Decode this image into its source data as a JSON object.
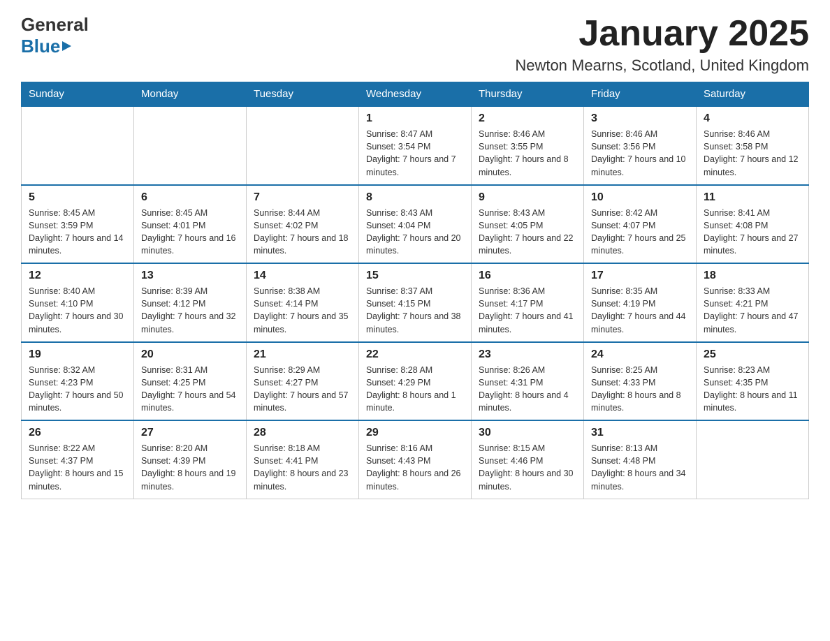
{
  "header": {
    "logo_line1": "General",
    "logo_line2": "Blue",
    "month_title": "January 2025",
    "location": "Newton Mearns, Scotland, United Kingdom"
  },
  "weekdays": [
    "Sunday",
    "Monday",
    "Tuesday",
    "Wednesday",
    "Thursday",
    "Friday",
    "Saturday"
  ],
  "weeks": [
    [
      {
        "day": "",
        "sunrise": "",
        "sunset": "",
        "daylight": ""
      },
      {
        "day": "",
        "sunrise": "",
        "sunset": "",
        "daylight": ""
      },
      {
        "day": "",
        "sunrise": "",
        "sunset": "",
        "daylight": ""
      },
      {
        "day": "1",
        "sunrise": "Sunrise: 8:47 AM",
        "sunset": "Sunset: 3:54 PM",
        "daylight": "Daylight: 7 hours and 7 minutes."
      },
      {
        "day": "2",
        "sunrise": "Sunrise: 8:46 AM",
        "sunset": "Sunset: 3:55 PM",
        "daylight": "Daylight: 7 hours and 8 minutes."
      },
      {
        "day": "3",
        "sunrise": "Sunrise: 8:46 AM",
        "sunset": "Sunset: 3:56 PM",
        "daylight": "Daylight: 7 hours and 10 minutes."
      },
      {
        "day": "4",
        "sunrise": "Sunrise: 8:46 AM",
        "sunset": "Sunset: 3:58 PM",
        "daylight": "Daylight: 7 hours and 12 minutes."
      }
    ],
    [
      {
        "day": "5",
        "sunrise": "Sunrise: 8:45 AM",
        "sunset": "Sunset: 3:59 PM",
        "daylight": "Daylight: 7 hours and 14 minutes."
      },
      {
        "day": "6",
        "sunrise": "Sunrise: 8:45 AM",
        "sunset": "Sunset: 4:01 PM",
        "daylight": "Daylight: 7 hours and 16 minutes."
      },
      {
        "day": "7",
        "sunrise": "Sunrise: 8:44 AM",
        "sunset": "Sunset: 4:02 PM",
        "daylight": "Daylight: 7 hours and 18 minutes."
      },
      {
        "day": "8",
        "sunrise": "Sunrise: 8:43 AM",
        "sunset": "Sunset: 4:04 PM",
        "daylight": "Daylight: 7 hours and 20 minutes."
      },
      {
        "day": "9",
        "sunrise": "Sunrise: 8:43 AM",
        "sunset": "Sunset: 4:05 PM",
        "daylight": "Daylight: 7 hours and 22 minutes."
      },
      {
        "day": "10",
        "sunrise": "Sunrise: 8:42 AM",
        "sunset": "Sunset: 4:07 PM",
        "daylight": "Daylight: 7 hours and 25 minutes."
      },
      {
        "day": "11",
        "sunrise": "Sunrise: 8:41 AM",
        "sunset": "Sunset: 4:08 PM",
        "daylight": "Daylight: 7 hours and 27 minutes."
      }
    ],
    [
      {
        "day": "12",
        "sunrise": "Sunrise: 8:40 AM",
        "sunset": "Sunset: 4:10 PM",
        "daylight": "Daylight: 7 hours and 30 minutes."
      },
      {
        "day": "13",
        "sunrise": "Sunrise: 8:39 AM",
        "sunset": "Sunset: 4:12 PM",
        "daylight": "Daylight: 7 hours and 32 minutes."
      },
      {
        "day": "14",
        "sunrise": "Sunrise: 8:38 AM",
        "sunset": "Sunset: 4:14 PM",
        "daylight": "Daylight: 7 hours and 35 minutes."
      },
      {
        "day": "15",
        "sunrise": "Sunrise: 8:37 AM",
        "sunset": "Sunset: 4:15 PM",
        "daylight": "Daylight: 7 hours and 38 minutes."
      },
      {
        "day": "16",
        "sunrise": "Sunrise: 8:36 AM",
        "sunset": "Sunset: 4:17 PM",
        "daylight": "Daylight: 7 hours and 41 minutes."
      },
      {
        "day": "17",
        "sunrise": "Sunrise: 8:35 AM",
        "sunset": "Sunset: 4:19 PM",
        "daylight": "Daylight: 7 hours and 44 minutes."
      },
      {
        "day": "18",
        "sunrise": "Sunrise: 8:33 AM",
        "sunset": "Sunset: 4:21 PM",
        "daylight": "Daylight: 7 hours and 47 minutes."
      }
    ],
    [
      {
        "day": "19",
        "sunrise": "Sunrise: 8:32 AM",
        "sunset": "Sunset: 4:23 PM",
        "daylight": "Daylight: 7 hours and 50 minutes."
      },
      {
        "day": "20",
        "sunrise": "Sunrise: 8:31 AM",
        "sunset": "Sunset: 4:25 PM",
        "daylight": "Daylight: 7 hours and 54 minutes."
      },
      {
        "day": "21",
        "sunrise": "Sunrise: 8:29 AM",
        "sunset": "Sunset: 4:27 PM",
        "daylight": "Daylight: 7 hours and 57 minutes."
      },
      {
        "day": "22",
        "sunrise": "Sunrise: 8:28 AM",
        "sunset": "Sunset: 4:29 PM",
        "daylight": "Daylight: 8 hours and 1 minute."
      },
      {
        "day": "23",
        "sunrise": "Sunrise: 8:26 AM",
        "sunset": "Sunset: 4:31 PM",
        "daylight": "Daylight: 8 hours and 4 minutes."
      },
      {
        "day": "24",
        "sunrise": "Sunrise: 8:25 AM",
        "sunset": "Sunset: 4:33 PM",
        "daylight": "Daylight: 8 hours and 8 minutes."
      },
      {
        "day": "25",
        "sunrise": "Sunrise: 8:23 AM",
        "sunset": "Sunset: 4:35 PM",
        "daylight": "Daylight: 8 hours and 11 minutes."
      }
    ],
    [
      {
        "day": "26",
        "sunrise": "Sunrise: 8:22 AM",
        "sunset": "Sunset: 4:37 PM",
        "daylight": "Daylight: 8 hours and 15 minutes."
      },
      {
        "day": "27",
        "sunrise": "Sunrise: 8:20 AM",
        "sunset": "Sunset: 4:39 PM",
        "daylight": "Daylight: 8 hours and 19 minutes."
      },
      {
        "day": "28",
        "sunrise": "Sunrise: 8:18 AM",
        "sunset": "Sunset: 4:41 PM",
        "daylight": "Daylight: 8 hours and 23 minutes."
      },
      {
        "day": "29",
        "sunrise": "Sunrise: 8:16 AM",
        "sunset": "Sunset: 4:43 PM",
        "daylight": "Daylight: 8 hours and 26 minutes."
      },
      {
        "day": "30",
        "sunrise": "Sunrise: 8:15 AM",
        "sunset": "Sunset: 4:46 PM",
        "daylight": "Daylight: 8 hours and 30 minutes."
      },
      {
        "day": "31",
        "sunrise": "Sunrise: 8:13 AM",
        "sunset": "Sunset: 4:48 PM",
        "daylight": "Daylight: 8 hours and 34 minutes."
      },
      {
        "day": "",
        "sunrise": "",
        "sunset": "",
        "daylight": ""
      }
    ]
  ]
}
